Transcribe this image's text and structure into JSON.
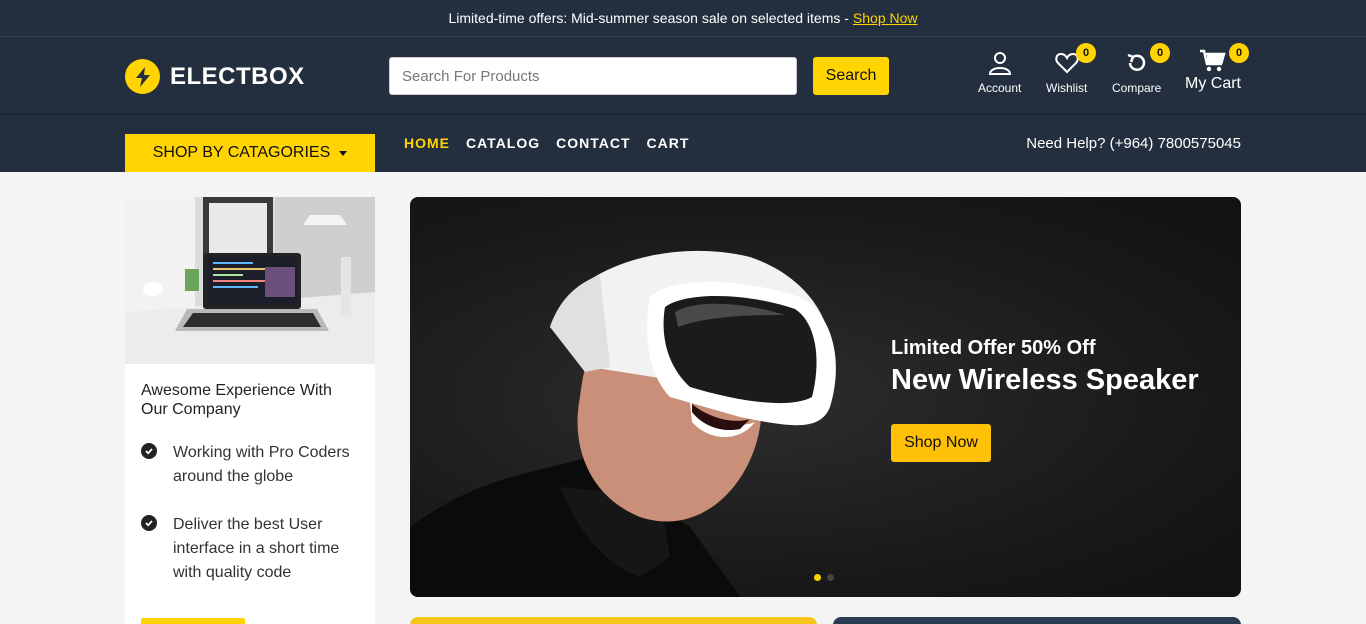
{
  "announcement": {
    "text": "Limited-time offers: Mid-summer season sale on selected items -",
    "link": "Shop Now"
  },
  "header": {
    "brand": "ELECTBOX",
    "search_placeholder": "Search For Products",
    "search_label": "Search",
    "account_label": "Account",
    "wishlist_label": "Wishlist",
    "wishlist_count": "0",
    "compare_label": "Compare",
    "compare_count": "0",
    "cart_label": "My Cart",
    "cart_count": "0"
  },
  "nav": {
    "categories_label": "SHOP BY CATAGORIES",
    "links": [
      "HOME",
      "CATALOG",
      "CONTACT",
      "CART"
    ],
    "active": "HOME",
    "help_text": "Need Help? (+964) 7800575045"
  },
  "sidebar": {
    "title": "Awesome Experience With Our Company",
    "points": [
      "Working with Pro Coders around the globe",
      "Deliver the best User interface in a short time with quality code"
    ]
  },
  "hero": {
    "subtitle": "Limited Offer 50% Off",
    "title": "New Wireless Speaker",
    "button": "Shop Now",
    "slide_count": 2,
    "active_slide": 1
  },
  "colors": {
    "navy": "#232f3e",
    "accent": "#ffd400",
    "hero_button": "#ffc107"
  }
}
